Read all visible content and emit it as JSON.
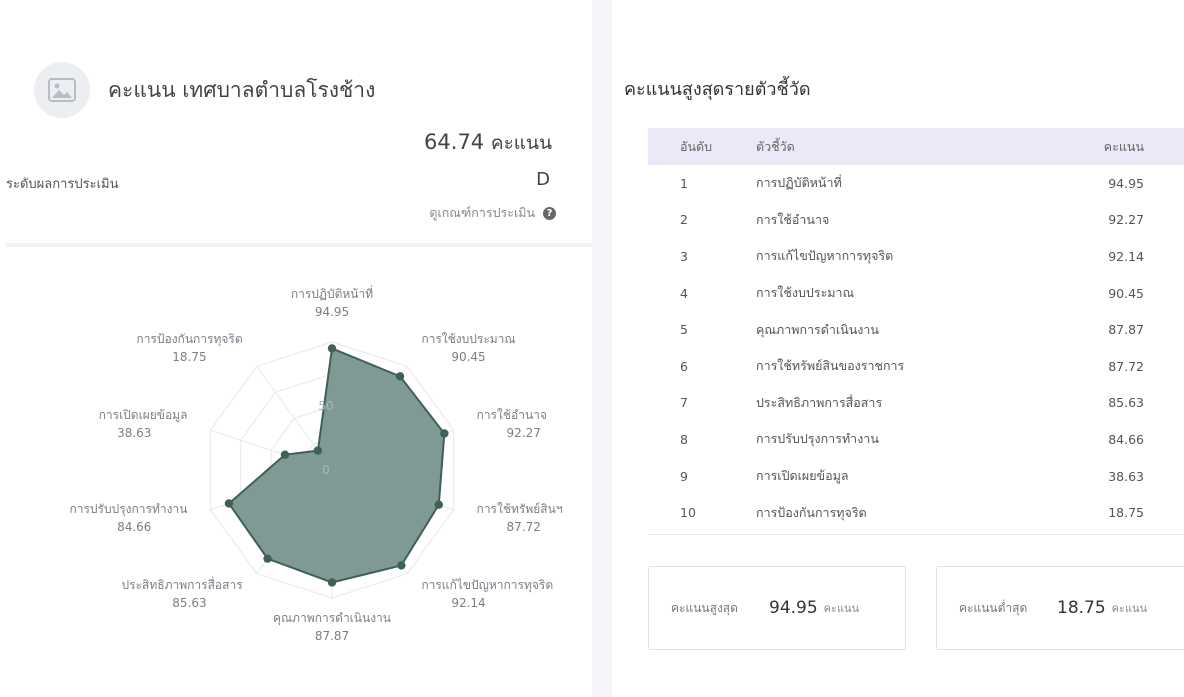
{
  "org": {
    "title": "คะแนน เทศบาลตำบลโรงช้าง"
  },
  "summary": {
    "total_score": "64.74",
    "score_unit": "คะแนน",
    "level_label": "ระดับผลการประเมิน",
    "level_value": "D",
    "criteria_link": "ดูเกณฑ์การประเมิน",
    "help_glyph": "?"
  },
  "icons": {
    "avatar": "image-placeholder-icon",
    "help": "question-circle-icon"
  },
  "colors": {
    "radar_fill": "#7f9a95",
    "radar_stroke": "#3f5f57",
    "header_bg": "#e9e9f7",
    "divider": "#f4f5f8"
  },
  "chart_data": {
    "type": "radar",
    "r_range": [
      0,
      100
    ],
    "tick_labels": [
      "0",
      "50"
    ],
    "categories": [
      "การปฏิบัติหน้าที่",
      "การใช้งบประมาณ",
      "การใช้อำนาจ",
      "การใช้ทรัพย์สินฯ",
      "การแก้ไขปัญหาการทุจริต",
      "คุณภาพการดำเนินงาน",
      "ประสิทธิภาพการสื่อสาร",
      "การปรับปรุงการทำงาน",
      "การเปิดเผยข้อมูล",
      "การป้องกันการทุจริต"
    ],
    "values": [
      94.95,
      90.45,
      92.27,
      87.72,
      92.14,
      87.87,
      85.63,
      84.66,
      38.63,
      18.75
    ],
    "value_labels": [
      "94.95",
      "90.45",
      "92.27",
      "87.72",
      "92.14",
      "87.87",
      "85.63",
      "84.66",
      "38.63",
      "18.75"
    ]
  },
  "ranking": {
    "title": "คะแนนสูงสุดรายตัวชี้วัด",
    "headers": {
      "rank": "อันดับ",
      "indicator": "ตัวชี้วัด",
      "score": "คะแนน"
    },
    "rows": [
      {
        "rank": "1",
        "name": "การปฏิบัติหน้าที่",
        "score": "94.95"
      },
      {
        "rank": "2",
        "name": "การใช้อำนาจ",
        "score": "92.27"
      },
      {
        "rank": "3",
        "name": "การแก้ไขปัญหาการทุจริต",
        "score": "92.14"
      },
      {
        "rank": "4",
        "name": "การใช้งบประมาณ",
        "score": "90.45"
      },
      {
        "rank": "5",
        "name": "คุณภาพการดำเนินงาน",
        "score": "87.87"
      },
      {
        "rank": "6",
        "name": "การใช้ทรัพย์สินของราชการ",
        "score": "87.72"
      },
      {
        "rank": "7",
        "name": "ประสิทธิภาพการสื่อสาร",
        "score": "85.63"
      },
      {
        "rank": "8",
        "name": "การปรับปรุงการทำงาน",
        "score": "84.66"
      },
      {
        "rank": "9",
        "name": "การเปิดเผยข้อมูล",
        "score": "38.63"
      },
      {
        "rank": "10",
        "name": "การป้องกันการทุจริต",
        "score": "18.75"
      }
    ]
  },
  "stats": {
    "max_label": "คะแนนสูงสุด",
    "max_value": "94.95",
    "max_unit": "คะแนน",
    "min_label": "คะแนนต่ำสุด",
    "min_value": "18.75",
    "min_unit": "คะแนน"
  }
}
